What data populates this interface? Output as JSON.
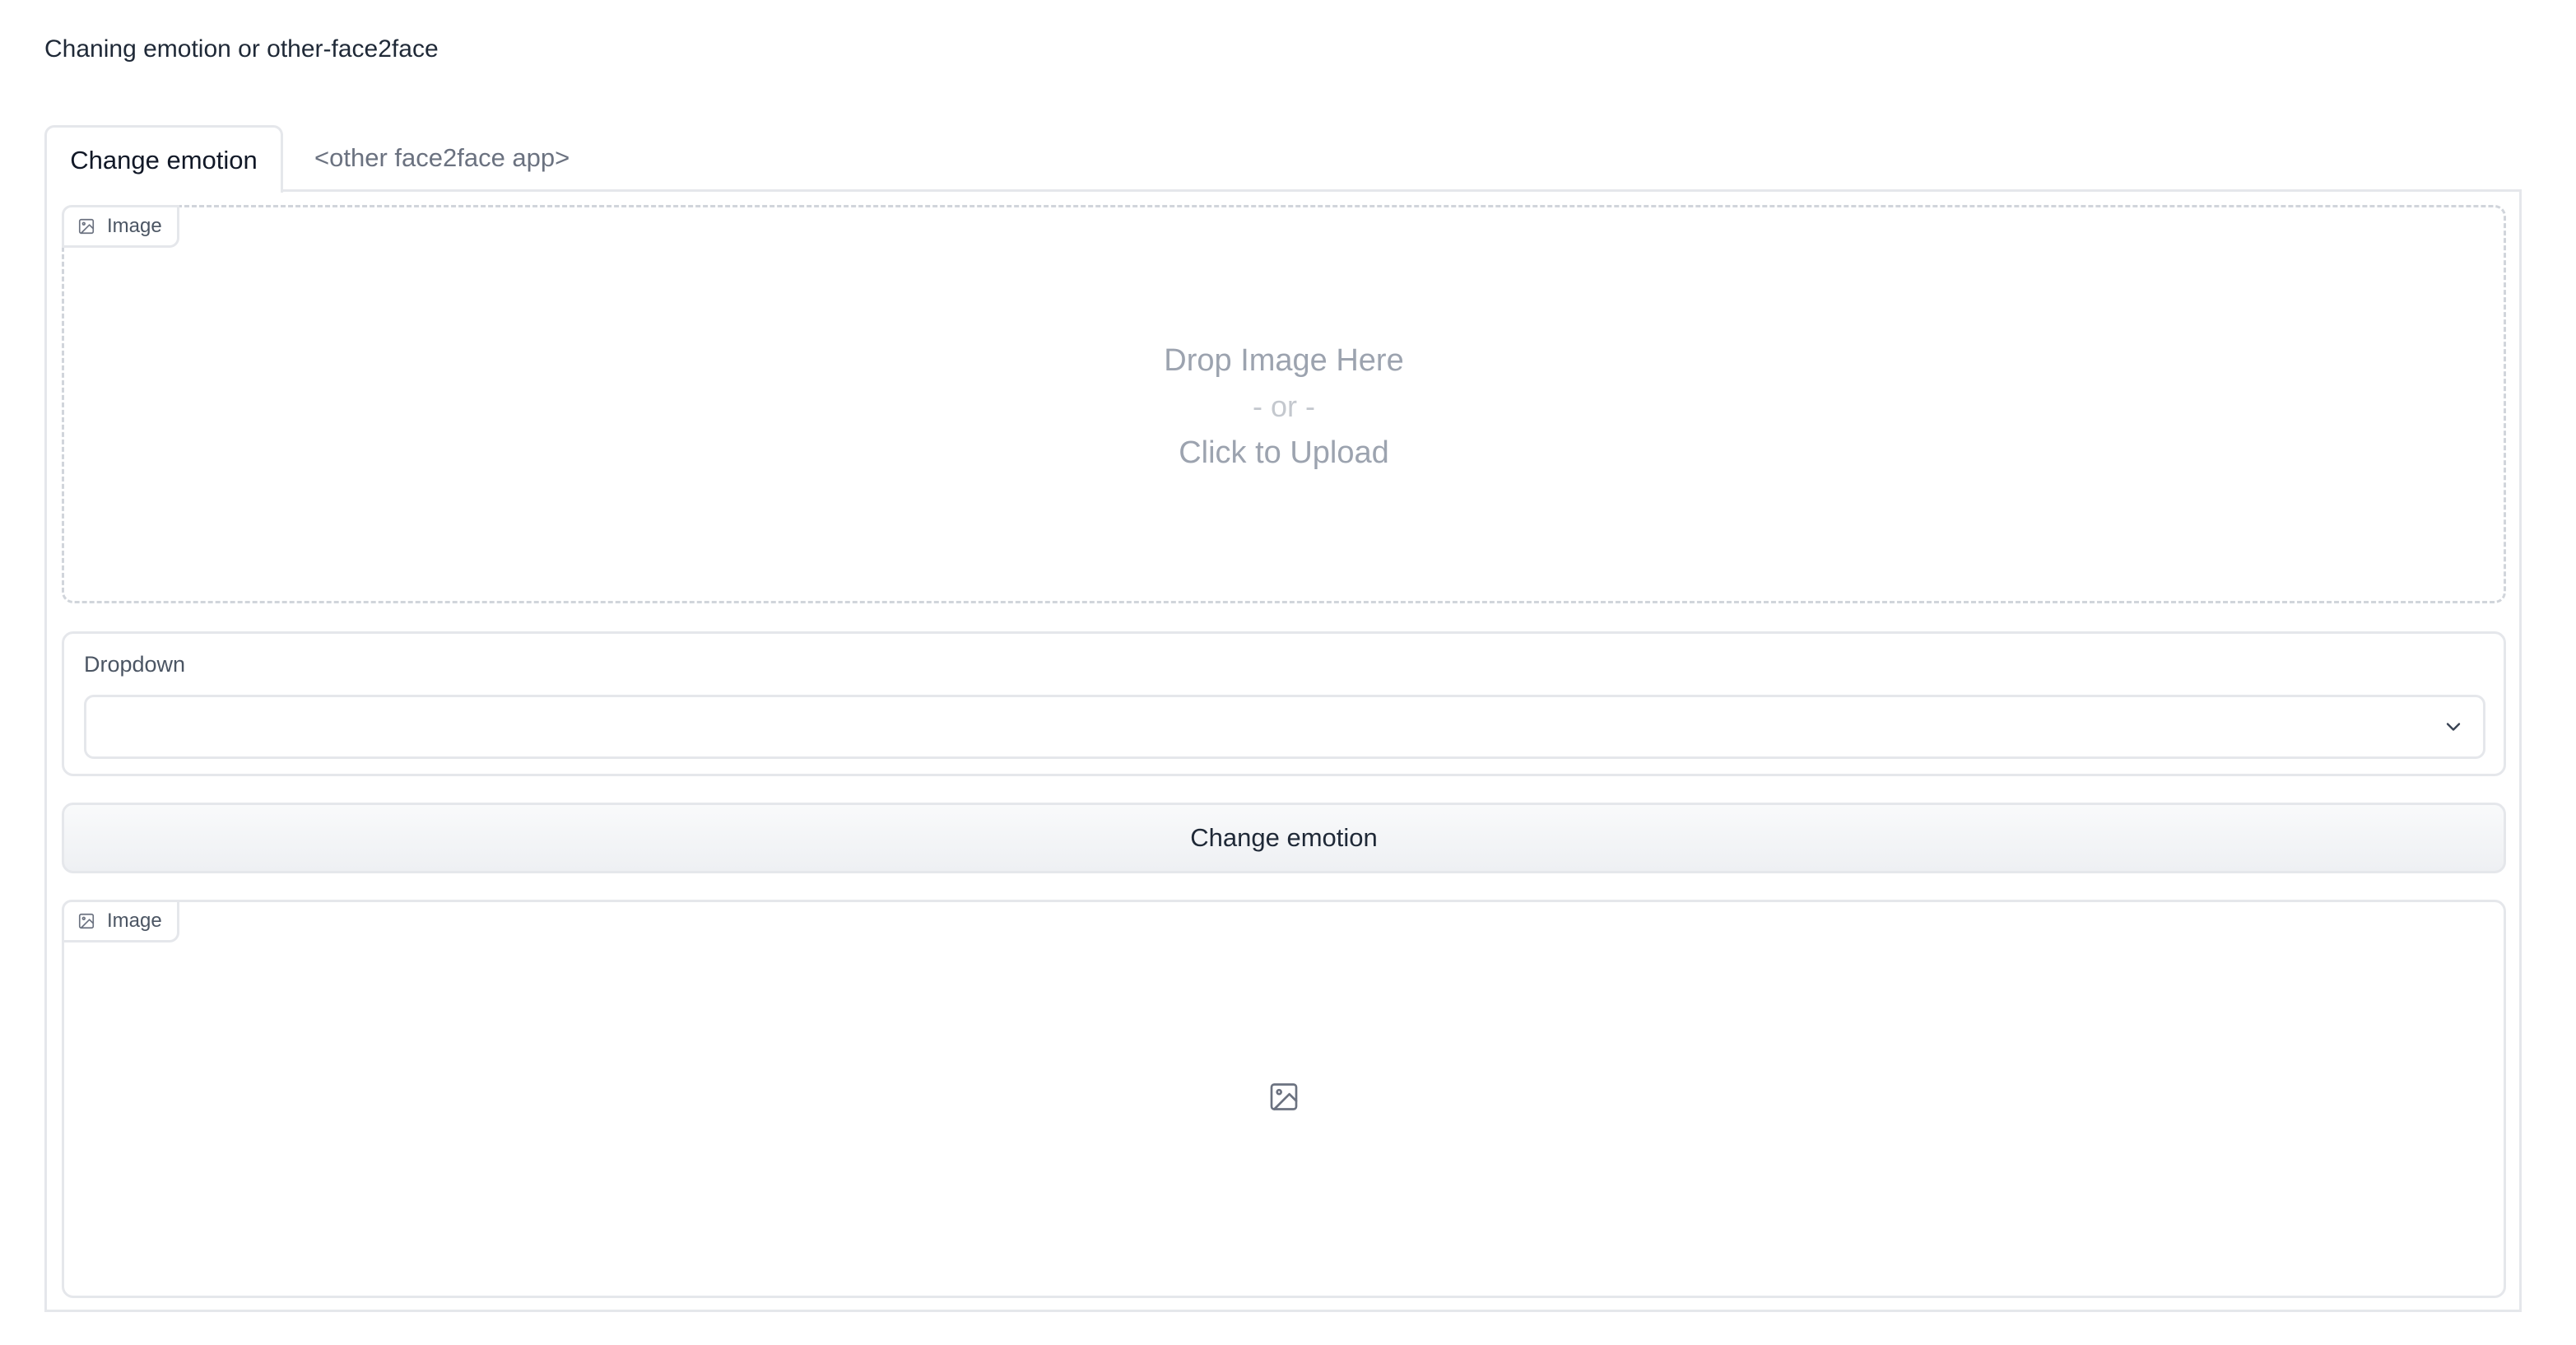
{
  "page": {
    "title": "Chaning emotion or other-face2face"
  },
  "tabs": [
    {
      "label": "Change emotion",
      "active": true
    },
    {
      "label": "<other face2face app>",
      "active": false
    }
  ],
  "input_image": {
    "label": "Image",
    "icon": "image-icon",
    "drop_text": "Drop Image Here",
    "or_text": "- or -",
    "upload_text": "Click to Upload"
  },
  "dropdown": {
    "label": "Dropdown",
    "value": "",
    "icon": "chevron-down-icon"
  },
  "action": {
    "label": "Change emotion"
  },
  "output_image": {
    "label": "Image",
    "icon": "image-icon",
    "placeholder_icon": "image-placeholder-icon"
  },
  "colors": {
    "border": "#e5e7eb",
    "muted_text": "#9ca3af",
    "text": "#1f2937",
    "button_bg": "#f3f4f6"
  }
}
